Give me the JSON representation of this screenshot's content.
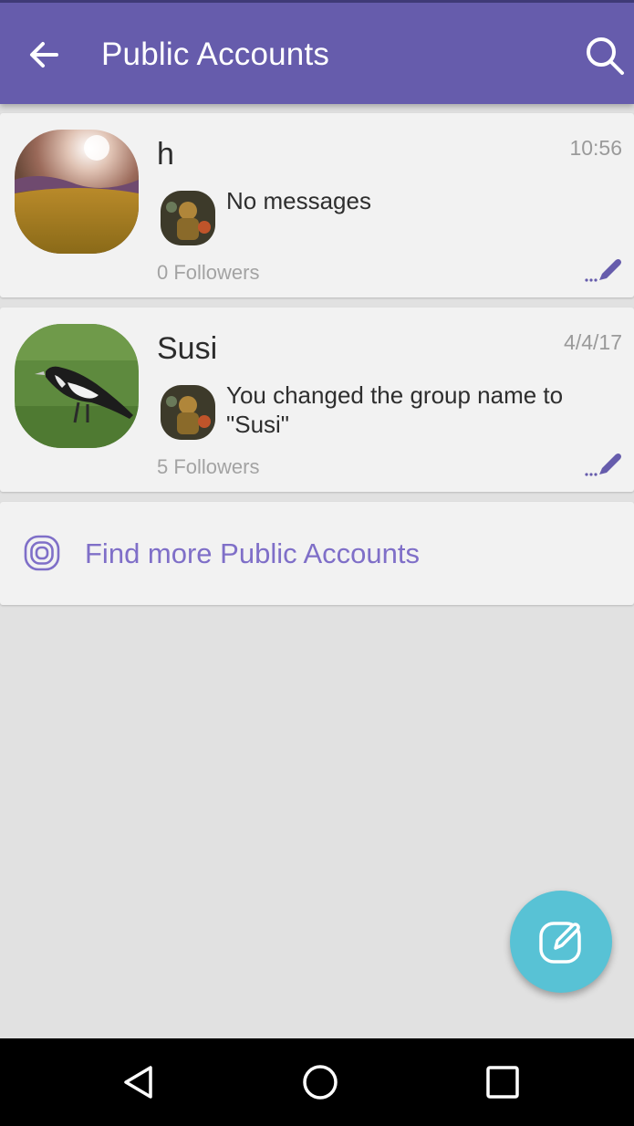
{
  "header": {
    "title": "Public Accounts",
    "back_icon": "arrow-back-icon",
    "search_icon": "search-icon",
    "color": "#665cac"
  },
  "accounts": [
    {
      "name": "h",
      "time": "10:56",
      "message": "No messages",
      "followers": "0 Followers"
    },
    {
      "name": "Susi",
      "time": "4/4/17",
      "message": "You changed the group name to \"Susi\"",
      "followers": "5 Followers"
    }
  ],
  "find_more": {
    "label": "Find more Public Accounts",
    "color": "#7f6fc8"
  },
  "fab": {
    "icon": "compose-icon",
    "color": "#58c2d5"
  },
  "nav": {
    "back": "nav-back-icon",
    "home": "nav-home-icon",
    "recents": "nav-recents-icon"
  }
}
